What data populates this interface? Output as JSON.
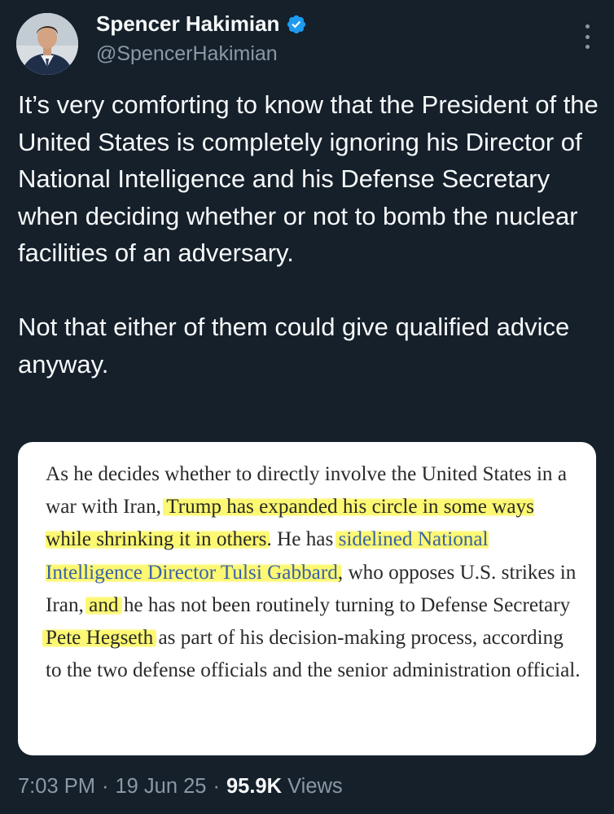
{
  "author": {
    "name": "Spencer Hakimian",
    "handle": "@SpencerHakimian",
    "verified_icon": "verified-badge-icon",
    "avatar_icon": "avatar-photo"
  },
  "tweet": {
    "text": "It’s very comforting to know that the President of the United States is completely ignoring his Director of National Intelligence and his Defense Secretary when deciding whether or not to bomb the nuclear facilities of an adversary.\n\nNot that either of them could give qualified advice anyway."
  },
  "card": {
    "segments": [
      {
        "text": "As he decides whether to directly involve the United States in a war with Iran, ",
        "style": "plain"
      },
      {
        "text": "Trump has expanded his circle in some ways while shrinking it in others",
        "style": "highlight"
      },
      {
        "text": ". He has ",
        "style": "plain"
      },
      {
        "text": "sidelined National Intelligence Director Tulsi Gabbard",
        "style": "highlight-link"
      },
      {
        "text": ", who opposes U.S. strikes in Iran, ",
        "style": "plain"
      },
      {
        "text": "and",
        "style": "highlight"
      },
      {
        "text": " he has not been routinely turning to Defense Secretary ",
        "style": "plain"
      },
      {
        "text": "Pete Hegseth",
        "style": "highlight"
      },
      {
        "text": " as part of his decision-making process, according to the two defense officials and the senior administration official.",
        "style": "plain"
      }
    ]
  },
  "meta": {
    "time": "7:03 PM",
    "separator1": "·",
    "date": "19 Jun 25",
    "separator2": "·",
    "views_count": "95.9K",
    "views_label": "Views"
  },
  "colors": {
    "background": "#15202b",
    "text": "#f7f9f9",
    "secondary_text": "#8b98a5",
    "verified": "#1d9bf0",
    "highlight": "#fcf75a",
    "link": "#3a62a8"
  }
}
